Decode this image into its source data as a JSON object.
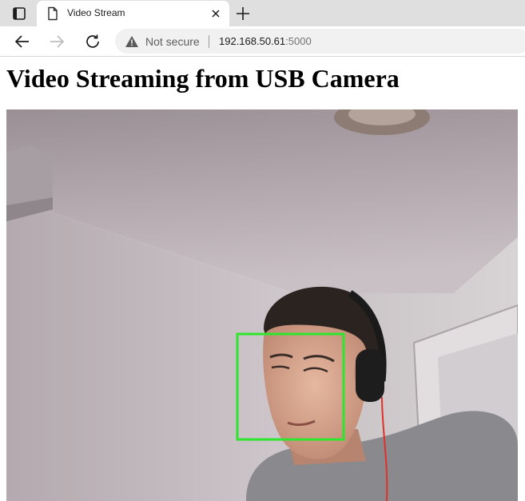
{
  "browser": {
    "tab": {
      "title": "Video Stream"
    },
    "address_bar": {
      "security_label": "Not secure",
      "url_host": "192.168.50.61",
      "url_port": ":5000"
    },
    "icons": {
      "tab_actions": "tab-actions-icon",
      "favicon": "page-document-icon",
      "close": "close-icon",
      "new_tab": "plus-icon",
      "back": "back-arrow-icon",
      "forward": "forward-arrow-icon",
      "reload": "reload-icon",
      "warning": "warning-triangle-icon"
    }
  },
  "page": {
    "title": "Video Streaming from USB Camera",
    "stream": {
      "description": "live camera feed",
      "detection_box_color": "#2ee62e"
    }
  }
}
